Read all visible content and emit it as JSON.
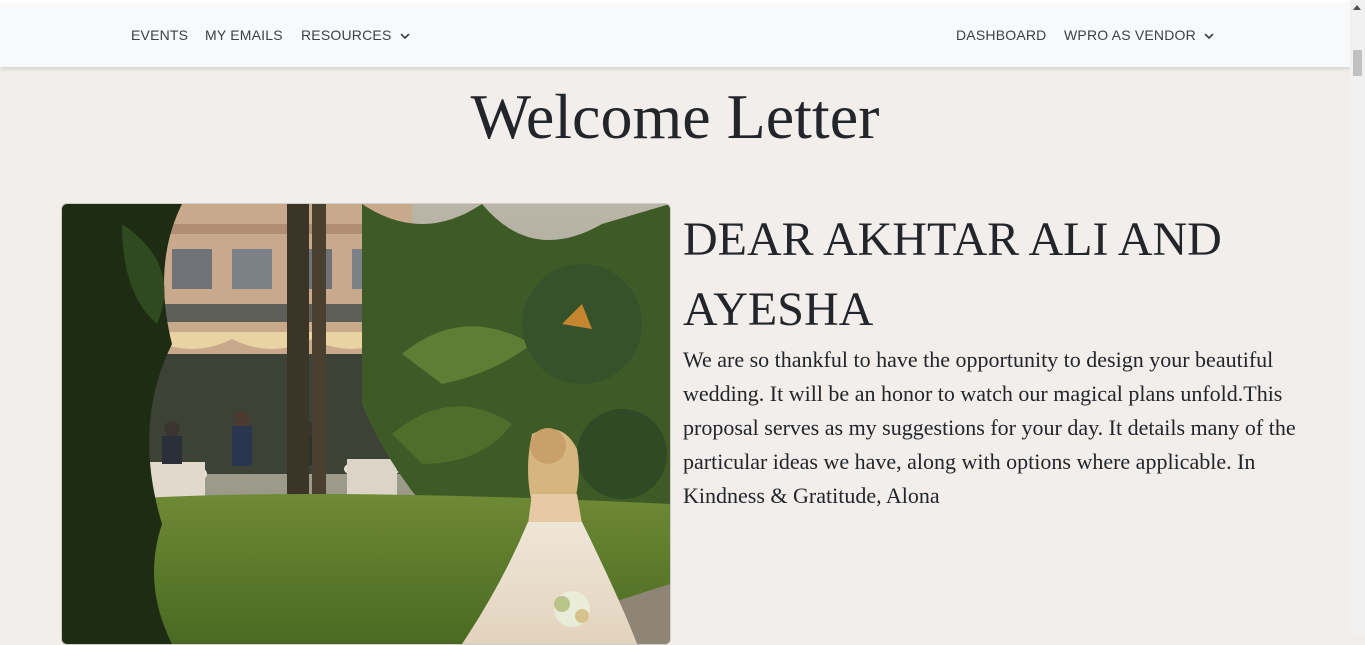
{
  "nav": {
    "left": [
      {
        "label": "EVENTS"
      },
      {
        "label": "MY EMAILS"
      },
      {
        "label": "RESOURCES",
        "icon": "chevron-down-icon"
      }
    ],
    "right": [
      {
        "label": "DASHBOARD"
      },
      {
        "label": "WPRO AS VENDOR",
        "icon": "chevron-down-icon"
      }
    ]
  },
  "page": {
    "title": "Welcome Letter",
    "greeting": "DEAR AKHTAR ALI AND AYESHA",
    "message": "We are so thankful to have the opportunity to design your beautiful wedding. It will be an honor to watch our magical plans unfold.This proposal serves as my suggestions for your day. It details many of the particular ideas we have, along with options where applicable. In Kindness & Gratitude, Alona"
  },
  "colors": {
    "page_background": "#f1eeeb",
    "navbar_background": "#f8f9fb",
    "text": "#22252a"
  }
}
